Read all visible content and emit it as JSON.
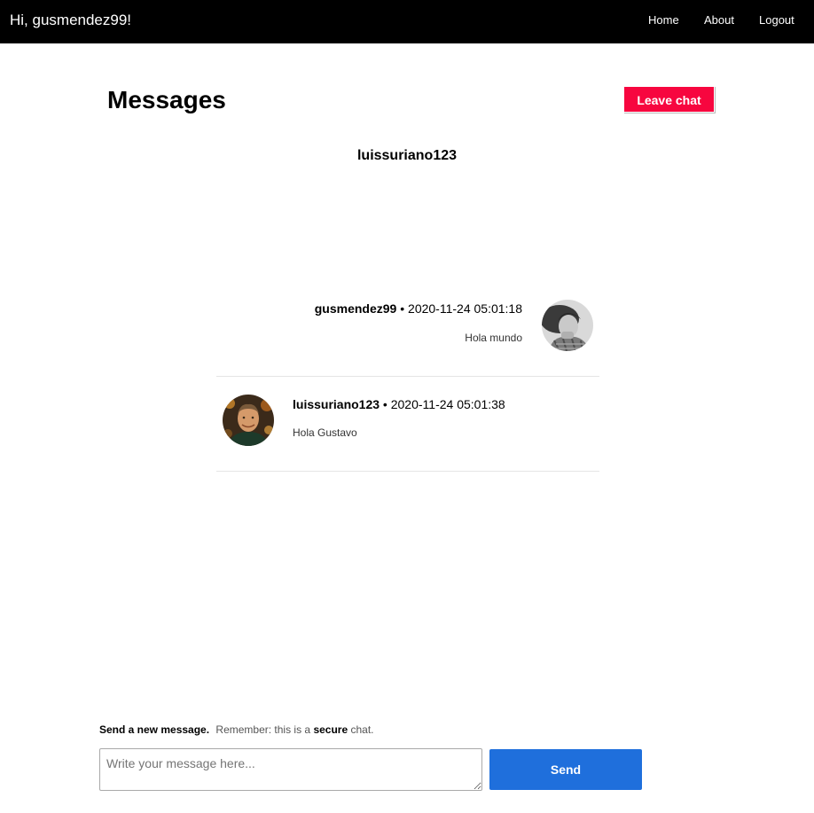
{
  "navbar": {
    "greeting": "Hi, gusmendez99!",
    "links": {
      "home": "Home",
      "about": "About",
      "logout": "Logout"
    }
  },
  "page": {
    "title": "Messages",
    "leave_label": "Leave chat",
    "chat_partner": "luissuriano123"
  },
  "messages": [
    {
      "author": "gusmendez99",
      "separator": " • ",
      "timestamp": "2020-11-24 05:01:18",
      "text": "Hola mundo",
      "direction": "sent",
      "avatar": "user-avatar"
    },
    {
      "author": "luissuriano123",
      "separator": " • ",
      "timestamp": "2020-11-24 05:01:38",
      "text": "Hola Gustavo",
      "direction": "received",
      "avatar": "user-avatar"
    }
  ],
  "composer": {
    "hint_lead": "Send a new message.",
    "hint_text": "Remember: this is a",
    "hint_strong": "secure",
    "hint_end": "chat.",
    "placeholder": "Write your message here...",
    "send_label": "Send"
  },
  "colors": {
    "navbar_bg": "#000000",
    "leave_button": "#f7063f",
    "send_button": "#1f6fdc"
  }
}
